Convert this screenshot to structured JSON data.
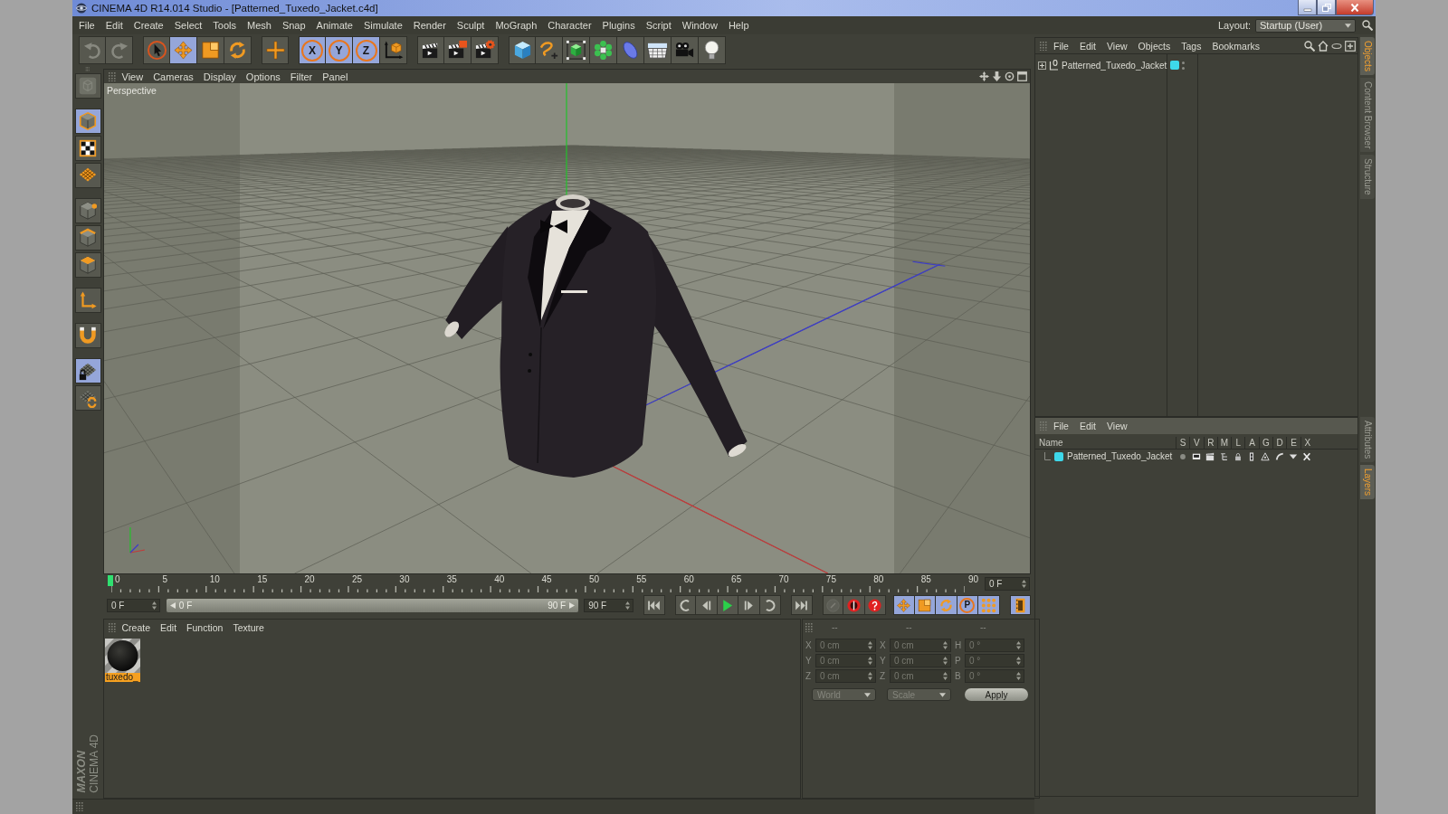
{
  "window": {
    "title": "CINEMA 4D R14.014 Studio - [Patterned_Tuxedo_Jacket.c4d]"
  },
  "menu_bar": {
    "items": [
      "File",
      "Edit",
      "Create",
      "Select",
      "Tools",
      "Mesh",
      "Snap",
      "Animate",
      "Simulate",
      "Render",
      "Sculpt",
      "MoGraph",
      "Character",
      "Plugins",
      "Script",
      "Window",
      "Help"
    ],
    "layout_label": "Layout:",
    "layout_value": "Startup (User)"
  },
  "toolbar": {
    "groups": [
      [
        {
          "kind": "undo",
          "selected": false,
          "disabled": true
        },
        {
          "kind": "redo",
          "selected": false,
          "disabled": true
        }
      ],
      [
        {
          "kind": "live-selection",
          "selected": false,
          "disabled": false
        },
        {
          "kind": "move",
          "selected": true,
          "disabled": false
        },
        {
          "kind": "scale",
          "selected": false,
          "disabled": false
        },
        {
          "kind": "rotate",
          "selected": false,
          "disabled": false
        }
      ],
      [
        {
          "kind": "plus",
          "selected": false,
          "disabled": false
        }
      ],
      [
        {
          "kind": "axis",
          "label": "X",
          "selected": true,
          "disabled": false
        },
        {
          "kind": "axis",
          "label": "Y",
          "selected": true,
          "disabled": false
        },
        {
          "kind": "axis",
          "label": "Z",
          "selected": true,
          "disabled": false
        },
        {
          "kind": "coordinate-system",
          "selected": false,
          "disabled": false
        }
      ],
      [
        {
          "kind": "render-view",
          "selected": false,
          "disabled": false
        },
        {
          "kind": "render-picture",
          "selected": false,
          "disabled": false
        },
        {
          "kind": "render-settings",
          "selected": false,
          "disabled": false
        }
      ],
      [
        {
          "kind": "cube",
          "selected": false,
          "disabled": false
        },
        {
          "kind": "spline-pen",
          "selected": false,
          "disabled": false
        },
        {
          "kind": "subdivision",
          "selected": false,
          "disabled": false
        },
        {
          "kind": "cloner",
          "selected": false,
          "disabled": false
        },
        {
          "kind": "deformer",
          "selected": false,
          "disabled": false
        },
        {
          "kind": "floor",
          "selected": false,
          "disabled": false
        },
        {
          "kind": "camera",
          "selected": false,
          "disabled": false
        },
        {
          "kind": "light",
          "selected": false,
          "disabled": false
        }
      ]
    ]
  },
  "tool_strip": {
    "groups": [
      [
        {
          "kind": "make-editable",
          "selected": false,
          "disabled": true
        }
      ],
      [
        {
          "kind": "model",
          "selected": true,
          "disabled": false
        },
        {
          "kind": "texture",
          "selected": false,
          "disabled": false
        },
        {
          "kind": "workplane",
          "selected": false,
          "disabled": false
        }
      ],
      [
        {
          "kind": "points",
          "selected": false,
          "disabled": false
        },
        {
          "kind": "edges",
          "selected": false,
          "disabled": false
        },
        {
          "kind": "polygons",
          "selected": false,
          "disabled": false
        }
      ],
      [
        {
          "kind": "axis-mode",
          "selected": false,
          "disabled": false
        }
      ],
      [
        {
          "kind": "tweak",
          "selected": false,
          "disabled": false
        }
      ],
      [
        {
          "kind": "workplane-lock",
          "selected": true,
          "disabled": false
        },
        {
          "kind": "snap",
          "selected": false,
          "disabled": false
        }
      ]
    ],
    "logo": {
      "brand": "MAXON",
      "product": "CINEMA 4D"
    }
  },
  "viewport": {
    "menu": [
      "View",
      "Cameras",
      "Display",
      "Options",
      "Filter",
      "Panel"
    ],
    "camera_label": "Perspective"
  },
  "timeline": {
    "labels": [
      "0",
      "5",
      "10",
      "15",
      "20",
      "25",
      "30",
      "35",
      "40",
      "45",
      "50",
      "55",
      "60",
      "65",
      "70",
      "75",
      "80",
      "85",
      "90"
    ],
    "level": 0,
    "current_frame": "0 F"
  },
  "transport": {
    "start_frame": "0 F",
    "range_start": "0 F",
    "range_end": "90 F",
    "level": 1,
    "end_frame": "90 F",
    "groups": [
      [
        {
          "kind": "go-start",
          "selected": false,
          "disabled": false
        }
      ],
      [
        {
          "kind": "prev-key",
          "selected": false,
          "disabled": false
        },
        {
          "kind": "prev-frame",
          "selected": false,
          "disabled": false
        },
        {
          "kind": "play",
          "selected": false,
          "disabled": false
        },
        {
          "kind": "next-frame",
          "selected": false,
          "disabled": false
        },
        {
          "kind": "next-key",
          "selected": false,
          "disabled": false
        }
      ],
      [
        {
          "kind": "go-end",
          "selected": false,
          "disabled": false
        }
      ],
      [
        {
          "kind": "record-off",
          "selected": false,
          "disabled": true
        },
        {
          "kind": "record",
          "selected": false,
          "disabled": false
        },
        {
          "kind": "autokey",
          "selected": false,
          "disabled": false
        }
      ],
      [
        {
          "kind": "key-move",
          "selected": true,
          "disabled": false
        },
        {
          "kind": "key-scale",
          "selected": true,
          "disabled": false
        },
        {
          "kind": "key-rotate",
          "selected": true,
          "disabled": false
        },
        {
          "kind": "key-param",
          "label": "P",
          "selected": true,
          "disabled": false
        },
        {
          "kind": "key-pla",
          "selected": true,
          "disabled": false
        }
      ],
      [
        {
          "kind": "timeline",
          "selected": true,
          "disabled": false
        }
      ]
    ]
  },
  "material_manager": {
    "menu": [
      "Create",
      "Edit",
      "Function",
      "Texture"
    ],
    "materials": [
      {
        "name": "tuxedo_",
        "selected": true
      }
    ]
  },
  "coordinates": {
    "disabled": true,
    "columns": [
      {
        "header": "--",
        "fields": [
          {
            "label": "X",
            "value": "0 cm"
          },
          {
            "label": "Y",
            "value": "0 cm"
          },
          {
            "label": "Z",
            "value": "0 cm"
          }
        ]
      },
      {
        "header": "--",
        "fields": [
          {
            "label": "X",
            "value": "0 cm"
          },
          {
            "label": "Y",
            "value": "0 cm"
          },
          {
            "label": "Z",
            "value": "0 cm"
          }
        ]
      },
      {
        "header": "--",
        "fields": [
          {
            "label": "H",
            "value": "0 °"
          },
          {
            "label": "P",
            "value": "0 °"
          },
          {
            "label": "B",
            "value": "0 °"
          }
        ]
      }
    ],
    "mode": "World",
    "type": "Scale",
    "apply": "Apply"
  },
  "object_manager": {
    "menu": [
      "File",
      "Edit",
      "View",
      "Objects",
      "Tags",
      "Bookmarks"
    ],
    "objects": [
      {
        "name": "Patterned_Tuxedo_Jacket",
        "color": "#3ed8ea",
        "expanded": false
      }
    ],
    "tabs": [
      {
        "label": "Objects",
        "selected": true
      },
      {
        "label": "Content Browser",
        "selected": false
      },
      {
        "label": "Structure",
        "selected": false
      }
    ]
  },
  "layer_manager": {
    "menu": [
      "File",
      "Edit",
      "View"
    ],
    "columns": [
      {
        "label": "Name",
        "kind": "name"
      },
      {
        "label": "S",
        "kind": "solo"
      },
      {
        "label": "V",
        "kind": "view"
      },
      {
        "label": "R",
        "kind": "render"
      },
      {
        "label": "M",
        "kind": "manager"
      },
      {
        "label": "L",
        "kind": "lock"
      },
      {
        "label": "A",
        "kind": "animation"
      },
      {
        "label": "G",
        "kind": "generators"
      },
      {
        "label": "D",
        "kind": "deformers"
      },
      {
        "label": "E",
        "kind": "expressions"
      },
      {
        "label": "X",
        "kind": "xrefs"
      }
    ],
    "layers": [
      {
        "name": "Patterned_Tuxedo_Jacket",
        "color": "#3ed8ea"
      }
    ],
    "tabs": [
      {
        "label": "Attributes",
        "selected": false
      },
      {
        "label": "Layers",
        "selected": true
      }
    ]
  }
}
